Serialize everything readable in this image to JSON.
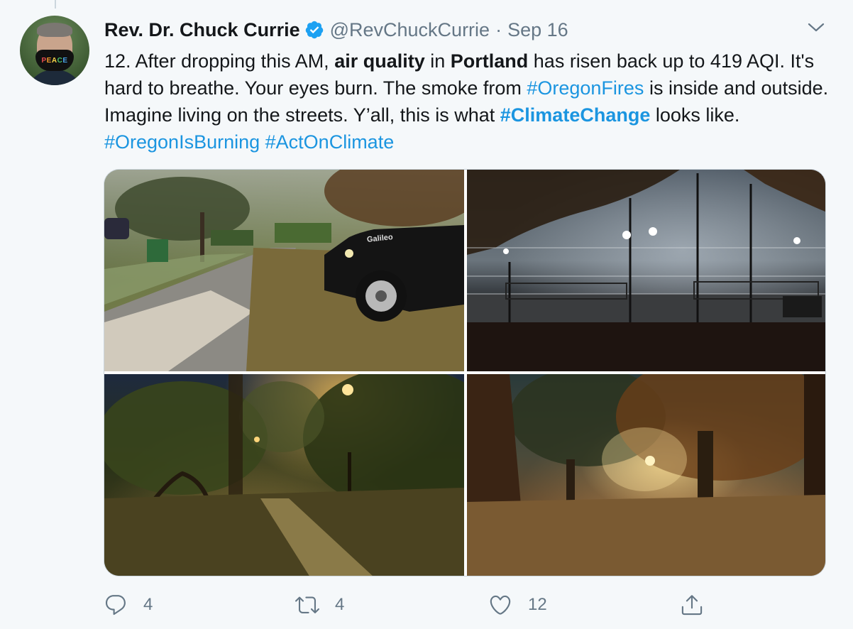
{
  "author": {
    "name": "Rev. Dr. Chuck Currie",
    "handle": "@RevChuckCurrie",
    "separator": "·",
    "date": "Sep 16",
    "avatar_mask_text": "PEACE"
  },
  "tweet": {
    "segments": [
      {
        "text": "12. After dropping this AM, ",
        "style": "plain"
      },
      {
        "text": "air quality",
        "style": "bold"
      },
      {
        "text": " in ",
        "style": "plain"
      },
      {
        "text": "Portland",
        "style": "bold"
      },
      {
        "text": " has risen back up to 419 AQI. It's hard to breathe. Your eyes burn. The smoke from ",
        "style": "plain"
      },
      {
        "text": "#OregonFires",
        "style": "hashtag"
      },
      {
        "text": " is inside and outside. Imagine living on the streets. Y’all, this is what ",
        "style": "plain"
      },
      {
        "text": "#ClimateChange",
        "style": "hashtag-bold"
      },
      {
        "text": " looks like. ",
        "style": "plain"
      },
      {
        "text": "#OregonIsBurning",
        "style": "hashtag"
      },
      {
        "text": " ",
        "style": "plain"
      },
      {
        "text": "#ActOnClimate",
        "style": "hashtag"
      }
    ]
  },
  "media": {
    "photos": [
      {
        "id": "photo-1",
        "subject": "smoky residential street with black jeep at dawn",
        "jeep_label": "Galileo"
      },
      {
        "id": "photo-2",
        "subject": "foggy tennis courts with lights at night"
      },
      {
        "id": "photo-3",
        "subject": "park path under street lamp at night"
      },
      {
        "id": "photo-4",
        "subject": "smoky park with large trees and lamp glow"
      }
    ]
  },
  "actions": {
    "reply_count": "4",
    "retweet_count": "4",
    "like_count": "12"
  },
  "colors": {
    "link": "#1b95e0",
    "muted": "#657786",
    "text": "#14171a",
    "verified": "#1da1f2",
    "background": "#f5f8fa"
  },
  "icons": [
    "verified-badge-icon",
    "caret-down-icon",
    "reply-icon",
    "retweet-icon",
    "like-icon",
    "share-icon"
  ]
}
